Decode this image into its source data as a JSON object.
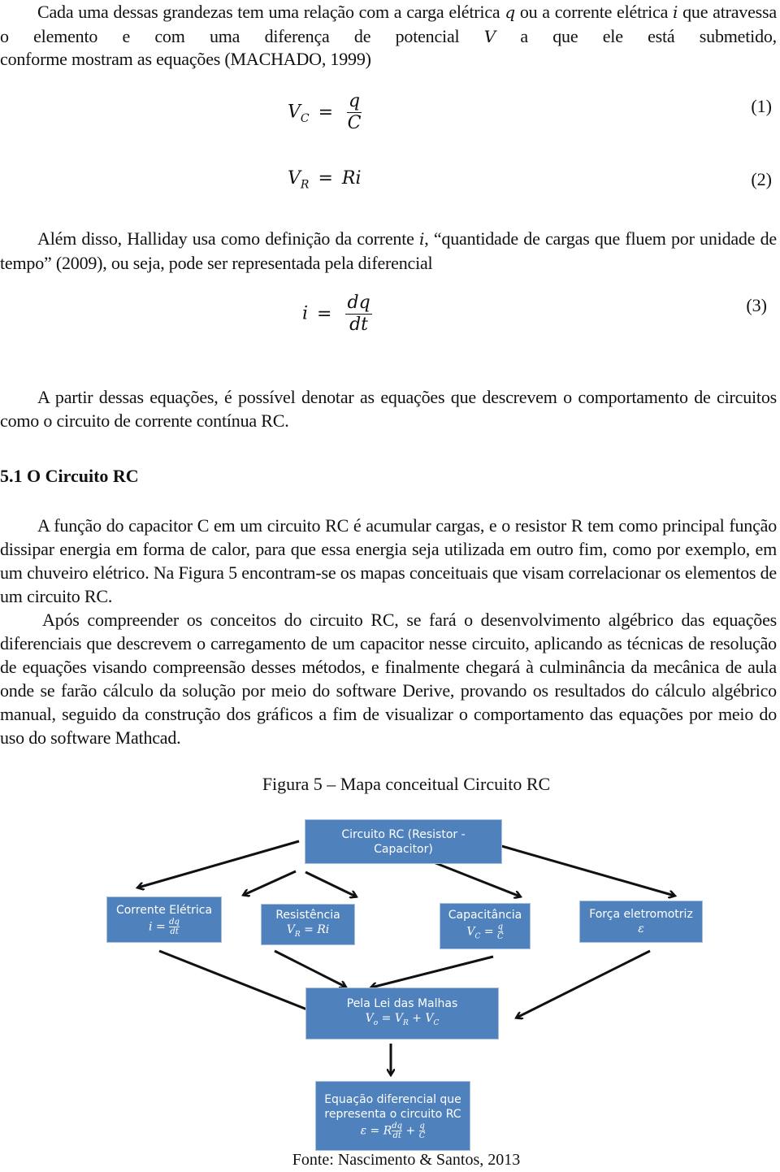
{
  "paragraphs": {
    "p1": "Cada uma dessas grandezas tem uma relação com a carga elétrica q ou a corrente elétrica i que atravessa o elemento e com uma diferença de potencial V a que ele está submetido, conforme mostram as equações (MACHADO, 1999)",
    "p1_line1": "Cada uma dessas grandezas tem uma relação com a carga elétrica",
    "p1_q": "q",
    "p1_line1b": "ou a corrente elétrica",
    "p1_i": "i",
    "p1_line2": "que atravessa o elemento e com uma diferença de potencial",
    "p1_V": "V",
    "p1_line2b": "a que ele está submetido,",
    "p1_line3": "conforme mostram as equações (MACHADO, 1999)",
    "p2_a": "Além disso, Halliday usa como definição da corrente",
    "p2_i": "i",
    "p2_b": ", “quantidade de cargas que fluem por unidade de tempo” (2009), ou seja, pode ser representada pela diferencial",
    "p3": "A partir dessas equações, é possível denotar as equações que descrevem o comportamento de circuitos como o circuito de corrente contínua RC.",
    "p4": "A função do capacitor C em um circuito RC é acumular cargas, e o resistor R tem como principal função dissipar energia em forma de calor, para que essa energia seja utilizada em outro fim, como por exemplo, em um chuveiro elétrico. Na Figura 5 encontram-se os mapas conceituais que visam correlacionar os elementos de um circuito RC.",
    "p5": "Após compreender os conceitos do circuito RC, se fará o desenvolvimento algébrico das equações diferenciais que descrevem o carregamento de um capacitor nesse circuito, aplicando as técnicas de resolução de equações visando compreensão desses métodos, e finalmente chegará à culminância da mecânica de aula onde se farão cálculo da solução por meio do software Derive, provando os resultados do cálculo algébrico manual, seguido da construção dos gráficos a fim de visualizar o comportamento das equações por meio do uso do software Mathcad."
  },
  "equations": [
    {
      "lhs": "V",
      "lhs_sub": "C",
      "op": "=",
      "num": "q",
      "den": "C",
      "number": "(1)"
    },
    {
      "lhs": "V",
      "lhs_sub": "R",
      "op": "=",
      "rhs": "Ri",
      "number": "(2)"
    },
    {
      "lhs": "i",
      "op": "=",
      "num": "dq",
      "den": "dt",
      "number": "(3)"
    }
  ],
  "section_heading": "5.1  O Circuito RC",
  "figure": {
    "caption": "Figura 5 – Mapa conceitual Circuito RC",
    "source": "Fonte: Nascimento & Santos, 2013",
    "box_color": "#4f81bd",
    "nodes": {
      "root": {
        "line1": "Circuito RC (Resistor -",
        "line2": "Capacitor)"
      },
      "current": {
        "title": "Corrente Elétrica",
        "lhs": "i =",
        "num": "dq",
        "den": "dt"
      },
      "resistance": {
        "title": "Resistência",
        "lhs": "V",
        "sub": "R",
        "rhs": "= Ri"
      },
      "capacitance": {
        "title": "Capacitância",
        "lhs": "V",
        "sub": "C",
        "eq": "=",
        "num": "q",
        "den": "C"
      },
      "emf": {
        "title": "Força eletromotriz",
        "symbol": "ε"
      },
      "mesh": {
        "title": "Pela Lei das Malhas",
        "lhs": "V",
        "sub0": "o",
        "eq": "= V",
        "sub1": "R",
        "plus": "+ V",
        "sub2": "C"
      },
      "diffeq": {
        "line1": "Equação diferencial que",
        "line2": "representa o circuito RC",
        "lhs": "ε = R",
        "num1": "dq",
        "den1": "dt",
        "plus": "+",
        "num2": "q",
        "den2": "C"
      }
    }
  }
}
